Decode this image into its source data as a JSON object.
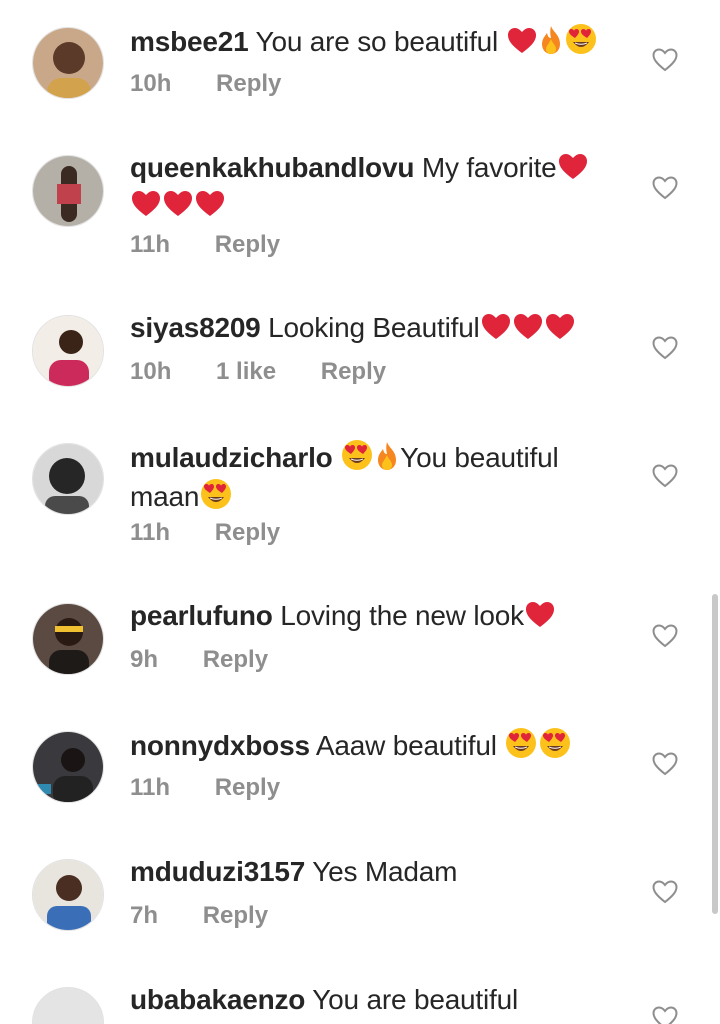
{
  "comments": [
    {
      "username": "msbee21",
      "text": "You are so beautiful",
      "emojis_after": [
        "heart",
        "fire",
        "heart-eyes"
      ],
      "time": "10h",
      "reply": "Reply",
      "avatar_color": "#6b4a3a"
    },
    {
      "username": "queenkakhubandlovu",
      "text": "My favorite",
      "emojis_after": [
        "heart",
        "heart",
        "heart",
        "heart"
      ],
      "time": "11h",
      "reply": "Reply",
      "avatar_color": "#8a8a86"
    },
    {
      "username": "siyas8209",
      "text": "Looking Beautiful",
      "emojis_after": [
        "heart",
        "heart",
        "heart"
      ],
      "time": "10h",
      "likes": "1 like",
      "reply": "Reply",
      "avatar_color": "#c2305a"
    },
    {
      "username": "mulaudzicharlo",
      "emojis_mid": [
        "heart-eyes",
        "fire"
      ],
      "text": "You beautiful maan",
      "emojis_after": [
        "heart-eyes"
      ],
      "time": "11h",
      "reply": "Reply",
      "avatar_color": "#3a3a3a"
    },
    {
      "username": "pearlufuno",
      "text": "Loving the new look",
      "emojis_after": [
        "heart"
      ],
      "time": "9h",
      "reply": "Reply",
      "avatar_color": "#4a3228"
    },
    {
      "username": "nonnydxboss",
      "text": "Aaaw beautiful",
      "emojis_after": [
        "heart-eyes",
        "heart-eyes"
      ],
      "time": "11h",
      "reply": "Reply",
      "avatar_color": "#2d2a30"
    },
    {
      "username": "mduduzi3157",
      "text": "Yes Madam",
      "emojis_after": [],
      "time": "7h",
      "reply": "Reply",
      "avatar_color": "#3a6fb8"
    },
    {
      "username": "ubabakaenzo",
      "text": "You are beautiful",
      "emojis_after": [],
      "time": "",
      "reply": "",
      "avatar_color": "#e4e4e4"
    }
  ],
  "icons": {
    "like": "heart-outline-icon"
  },
  "colors": {
    "text": "#262626",
    "meta": "#8e8e8e",
    "heart": "#e0243a"
  }
}
